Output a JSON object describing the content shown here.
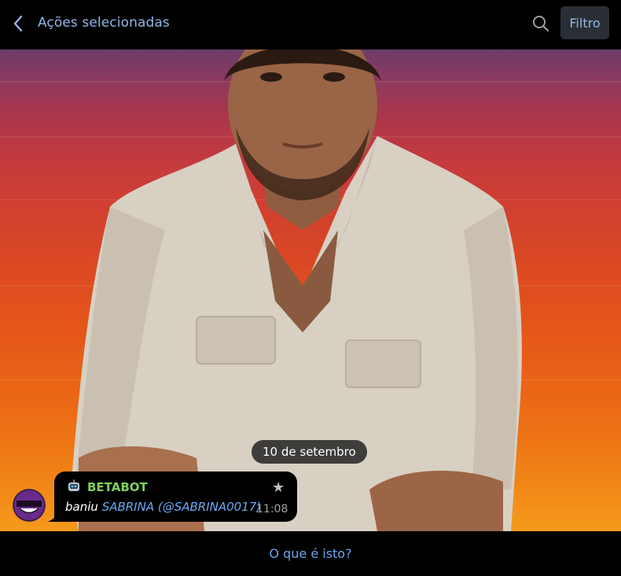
{
  "header": {
    "title": "Ações selecionadas",
    "filter_label": "Filtro"
  },
  "chat": {
    "date_separator": "10 de setembro",
    "message": {
      "sender": "BETABOT",
      "sender_color": "#7fd15b",
      "action": "baniu",
      "user_name": "SABRINA",
      "user_handle": "(@SABRINA0017)",
      "time": "11:08",
      "star_icon": "star-icon"
    }
  },
  "footer": {
    "help_link": "O que é isto?"
  },
  "colors": {
    "accent": "#8fb6e6",
    "link": "#6aa9f2",
    "background": "#000000"
  },
  "icons": [
    "back-arrow-icon",
    "search-icon",
    "robot-icon",
    "star-icon",
    "avatar-face-icon"
  ]
}
